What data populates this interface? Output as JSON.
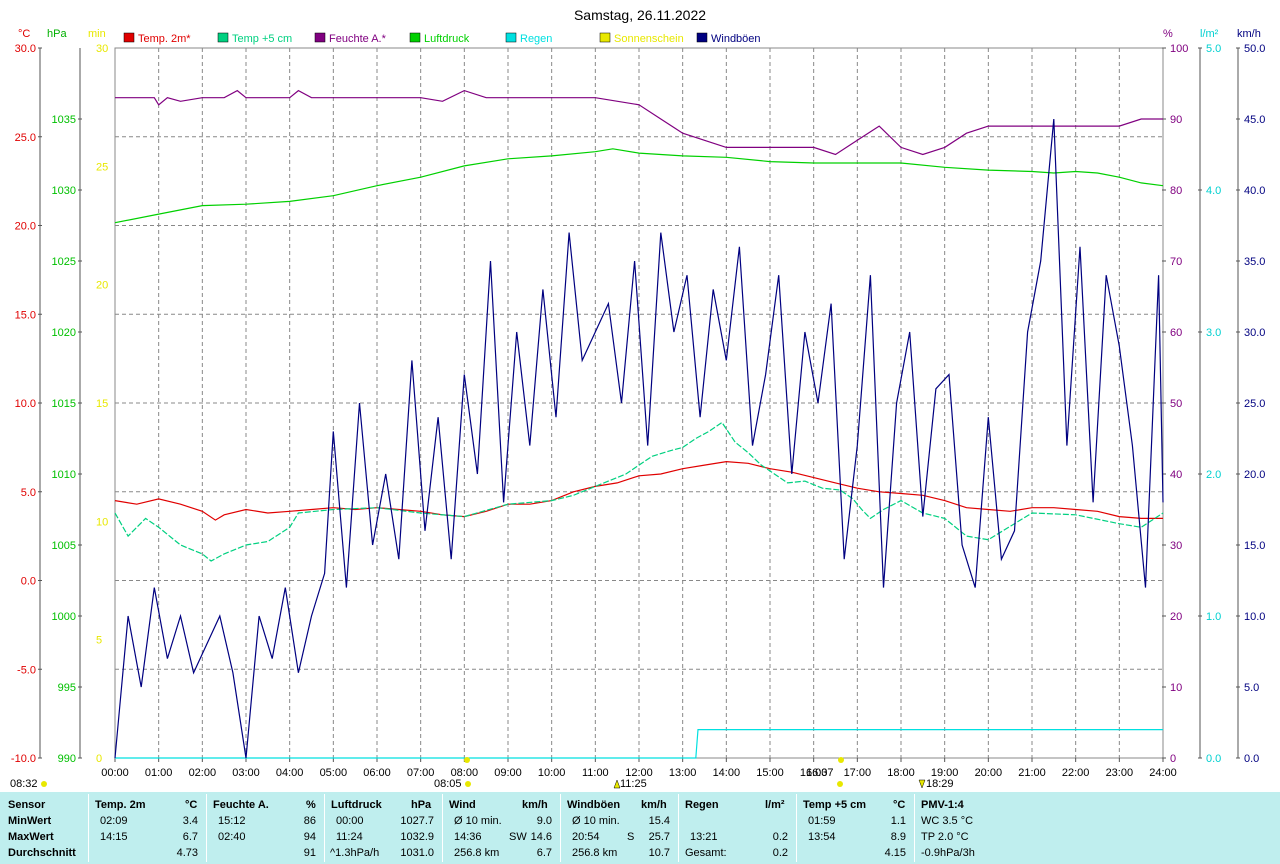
{
  "title": "Samstag, 26.11.2022",
  "axis_units": {
    "temp": "°C",
    "pressure": "hPa",
    "sun": "min",
    "humidity": "%",
    "rain": "l/m²",
    "wind": "km/h"
  },
  "legend": [
    {
      "label": "Temp. 2m*",
      "color": "#e00000"
    },
    {
      "label": "Temp +5 cm",
      "color": "#00d080"
    },
    {
      "label": "Feuchte A.*",
      "color": "#800080"
    },
    {
      "label": "Luftdruck",
      "color": "#00d000"
    },
    {
      "label": "Regen",
      "color": "#00e0e0"
    },
    {
      "label": "Sonnenschein",
      "color": "#e8e800"
    },
    {
      "label": "Windböen",
      "color": "#000080"
    }
  ],
  "sun_events": {
    "sunrise": "08:32",
    "dawn": "08:05",
    "noon": "11:25",
    "dusk": "16:37",
    "sunset": "18:29"
  },
  "chart_data": {
    "type": "line",
    "title": "Samstag, 26.11.2022",
    "x_ticks": [
      "00:00",
      "01:00",
      "02:00",
      "03:00",
      "04:00",
      "05:00",
      "06:00",
      "07:00",
      "08:00",
      "09:00",
      "10:00",
      "11:00",
      "12:00",
      "13:00",
      "14:00",
      "15:00",
      "16:00",
      "17:00",
      "18:00",
      "19:00",
      "20:00",
      "21:00",
      "22:00",
      "23:00",
      "24:00"
    ],
    "xlim": [
      0,
      24
    ],
    "grid": true,
    "axes": {
      "temp": {
        "ticks": [
          "30.0",
          "25.0",
          "20.0",
          "15.0",
          "10.0",
          "5.0",
          "0.0",
          "-5.0",
          "-10.0"
        ],
        "ylim": [
          -10,
          30
        ],
        "color": "#e00000"
      },
      "pressure": {
        "ticks": [
          "1035",
          "1030",
          "1025",
          "1020",
          "1015",
          "1010",
          "1005",
          "1000",
          "995",
          "990"
        ],
        "ylim": [
          990,
          1040
        ],
        "color": "#00c000"
      },
      "sun": {
        "ticks": [
          "30",
          "25",
          "20",
          "15",
          "10",
          "5",
          "0"
        ],
        "ylim": [
          0,
          30
        ],
        "color": "#e8e800"
      },
      "humidity": {
        "ticks": [
          "100",
          "90",
          "80",
          "70",
          "60",
          "50",
          "40",
          "30",
          "20",
          "10",
          "0"
        ],
        "ylim": [
          0,
          100
        ],
        "color": "#800080"
      },
      "rain": {
        "ticks": [
          "5.0",
          "4.0",
          "3.0",
          "2.0",
          "1.0",
          "0.0"
        ],
        "ylim": [
          0,
          5
        ],
        "color": "#00e0e0"
      },
      "wind": {
        "ticks": [
          "50.0",
          "45.0",
          "40.0",
          "35.0",
          "30.0",
          "25.0",
          "20.0",
          "15.0",
          "10.0",
          "5.0",
          "0.0"
        ],
        "ylim": [
          0,
          50
        ],
        "color": "#000080"
      }
    },
    "series": [
      {
        "name": "Temp. 2m*",
        "axis": "temp",
        "color": "#e00000",
        "x": [
          0,
          0.5,
          1,
          1.5,
          2,
          2.3,
          2.5,
          3,
          3.5,
          4,
          4.5,
          5,
          5.5,
          6,
          6.5,
          7,
          7.5,
          8,
          8.5,
          9,
          9.5,
          10,
          10.5,
          11,
          11.5,
          12,
          12.5,
          13,
          13.5,
          14,
          14.5,
          15,
          15.5,
          16,
          16.5,
          17,
          17.5,
          18,
          18.5,
          19,
          19.5,
          20,
          20.5,
          21,
          21.5,
          22,
          22.5,
          23,
          23.5,
          24
        ],
        "y": [
          4.5,
          4.3,
          4.6,
          4.3,
          3.9,
          3.4,
          3.7,
          4.0,
          3.8,
          3.9,
          4.0,
          4.1,
          4.0,
          4.1,
          4.0,
          3.9,
          3.7,
          3.6,
          3.9,
          4.3,
          4.3,
          4.5,
          5.0,
          5.3,
          5.5,
          5.9,
          6.0,
          6.3,
          6.5,
          6.7,
          6.6,
          6.3,
          6.1,
          5.8,
          5.5,
          5.2,
          5.0,
          4.9,
          4.8,
          4.5,
          4.1,
          4.0,
          3.9,
          4.1,
          4.1,
          4.0,
          3.9,
          3.6,
          3.5,
          3.5
        ]
      },
      {
        "name": "Temp +5 cm",
        "axis": "temp",
        "color": "#00d080",
        "x": [
          0,
          0.3,
          0.7,
          1,
          1.5,
          2,
          2.2,
          2.5,
          3,
          3.5,
          4,
          4.2,
          5,
          6,
          7,
          8,
          9,
          10,
          10.5,
          11,
          11.3,
          11.7,
          12,
          12.3,
          12.7,
          13,
          13.3,
          13.6,
          13.9,
          14.2,
          14.5,
          14.8,
          15.1,
          15.4,
          15.8,
          16.2,
          16.6,
          16.9,
          17.1,
          17.3,
          17.6,
          18,
          18.5,
          19,
          19.5,
          20,
          21,
          22,
          23,
          23.5,
          24
        ],
        "y": [
          3.8,
          2.5,
          3.5,
          3.0,
          2.0,
          1.5,
          1.1,
          1.5,
          2.0,
          2.2,
          3.0,
          3.8,
          4.0,
          4.1,
          3.8,
          3.6,
          4.3,
          4.5,
          4.8,
          5.3,
          5.6,
          6.0,
          6.5,
          7.0,
          7.3,
          7.5,
          8.0,
          8.4,
          8.9,
          7.8,
          7.2,
          6.5,
          6.0,
          5.5,
          5.6,
          5.2,
          5.1,
          4.6,
          4.0,
          3.5,
          4.0,
          4.5,
          3.8,
          3.5,
          2.5,
          2.3,
          3.8,
          3.7,
          3.2,
          3.0,
          3.8
        ]
      },
      {
        "name": "Feuchte A.*",
        "axis": "humidity",
        "color": "#800080",
        "x": [
          0,
          0.9,
          1,
          1.2,
          1.5,
          2,
          2.5,
          2.8,
          3,
          3.5,
          4,
          4.2,
          4.5,
          5,
          5.5,
          6,
          6.5,
          7,
          7.5,
          8,
          8.5,
          9,
          10,
          11,
          12,
          12.5,
          13,
          13.5,
          14,
          14.5,
          15,
          16,
          16.5,
          17,
          17.5,
          18,
          18.5,
          19,
          19.5,
          20,
          21,
          22,
          23,
          23.5,
          24
        ],
        "y": [
          93,
          93,
          92,
          93,
          92.5,
          93,
          93,
          94,
          93,
          93,
          93,
          94,
          93,
          93,
          93,
          93,
          93,
          93,
          92.5,
          94,
          93,
          93,
          93,
          93,
          92,
          90,
          88,
          87,
          86,
          86,
          86,
          86,
          85,
          87,
          89,
          86,
          85,
          86,
          88,
          89,
          89,
          89,
          89,
          90,
          90
        ]
      },
      {
        "name": "Luftdruck",
        "axis": "pressure",
        "color": "#00d000",
        "x": [
          0,
          1,
          2,
          3,
          4,
          5,
          6,
          7,
          8,
          9,
          10,
          11,
          11.4,
          12,
          13,
          14,
          15,
          16,
          17,
          18,
          19,
          20,
          21,
          21.5,
          22,
          22.5,
          23,
          23.5,
          24
        ],
        "y": [
          1027.7,
          1028.3,
          1028.9,
          1029.0,
          1029.2,
          1029.6,
          1030.3,
          1030.9,
          1031.7,
          1032.2,
          1032.4,
          1032.7,
          1032.9,
          1032.6,
          1032.4,
          1032.3,
          1032.0,
          1031.9,
          1031.9,
          1031.9,
          1031.6,
          1031.4,
          1031.3,
          1031.2,
          1031.3,
          1031.2,
          1030.9,
          1030.5,
          1030.3
        ]
      },
      {
        "name": "Regen",
        "axis": "rain",
        "color": "#00e0e0",
        "x": [
          0,
          13.3,
          13.35,
          24
        ],
        "y": [
          0,
          0,
          0.2,
          0.2
        ]
      },
      {
        "name": "Windböen",
        "axis": "wind",
        "color": "#000080",
        "x": [
          0,
          0.3,
          0.6,
          0.9,
          1.2,
          1.5,
          1.8,
          2.1,
          2.4,
          2.7,
          3.0,
          3.3,
          3.6,
          3.9,
          4.2,
          4.5,
          4.8,
          5.0,
          5.3,
          5.6,
          5.9,
          6.2,
          6.5,
          6.8,
          7.1,
          7.4,
          7.7,
          8.0,
          8.3,
          8.6,
          8.9,
          9.2,
          9.5,
          9.8,
          10.1,
          10.4,
          10.7,
          11.0,
          11.3,
          11.6,
          11.9,
          12.2,
          12.5,
          12.8,
          13.1,
          13.4,
          13.7,
          14.0,
          14.3,
          14.6,
          14.9,
          15.2,
          15.5,
          15.8,
          16.1,
          16.4,
          16.7,
          17.0,
          17.3,
          17.6,
          17.9,
          18.2,
          18.5,
          18.8,
          19.1,
          19.4,
          19.7,
          20.0,
          20.3,
          20.6,
          20.9,
          21.2,
          21.5,
          21.8,
          22.1,
          22.4,
          22.7,
          23.0,
          23.3,
          23.6,
          23.9,
          24
        ],
        "y": [
          0,
          10,
          5,
          12,
          7,
          10,
          6,
          8,
          10,
          6,
          0,
          10,
          7,
          12,
          6,
          10,
          13,
          23,
          12,
          25,
          15,
          20,
          14,
          28,
          16,
          24,
          14,
          27,
          20,
          35,
          18,
          30,
          22,
          33,
          24,
          37,
          28,
          30,
          32,
          25,
          35,
          22,
          37,
          30,
          34,
          24,
          33,
          28,
          36,
          22,
          27,
          34,
          20,
          30,
          25,
          32,
          14,
          22,
          34,
          12,
          25,
          30,
          17,
          26,
          27,
          15,
          12,
          24,
          14,
          16,
          30,
          35,
          45,
          22,
          36,
          18,
          34,
          29,
          22,
          12,
          34,
          18
        ]
      }
    ]
  },
  "stats": {
    "headers": [
      {
        "name": "Sensor",
        "unit": ""
      },
      {
        "name": "Temp. 2m",
        "unit": "°C"
      },
      {
        "name": "Feuchte A.",
        "unit": "%"
      },
      {
        "name": "Luftdruck",
        "unit": "hPa"
      },
      {
        "name": "Wind",
        "unit": "km/h"
      },
      {
        "name": "Windböen",
        "unit": "km/h"
      },
      {
        "name": "Regen",
        "unit": "l/m²"
      },
      {
        "name": "Temp +5 cm",
        "unit": "°C"
      },
      {
        "name": "PMV-1:4",
        "unit": ""
      }
    ],
    "rows": [
      {
        "label": "MinWert",
        "temp_time": "02:09",
        "temp_val": "3.4",
        "hum_time": "15:12",
        "hum_val": "86",
        "press_time": "00:00",
        "press_val": "1027.7",
        "wind_label": "Ø 10 min.",
        "wind_dir": "",
        "wind_val": "9.0",
        "gust_label": "Ø 10 min.",
        "gust_dir": "",
        "gust_val": "15.4",
        "rain_time": "",
        "rain_val": "",
        "t5_time": "01:59",
        "t5_val": "1.1",
        "pmv": "WC 3.5 °C"
      },
      {
        "label": "MaxWert",
        "temp_time": "14:15",
        "temp_val": "6.7",
        "hum_time": "02:40",
        "hum_val": "94",
        "press_time": "11:24",
        "press_val": "1032.9",
        "wind_label": "14:36",
        "wind_dir": "SW",
        "wind_val": "14.6",
        "gust_label": "20:54",
        "gust_dir": "S",
        "gust_val": "25.7",
        "rain_time": "13:21",
        "rain_val": "0.2",
        "t5_time": "13:54",
        "t5_val": "8.9",
        "pmv": "TP 2.0 °C"
      },
      {
        "label": "Durchschnitt",
        "temp_time": "",
        "temp_val": "4.73",
        "hum_time": "",
        "hum_val": "91",
        "press_time": "^1.3hPa/h",
        "press_val": "1031.0",
        "wind_label": "256.8 km",
        "wind_dir": "",
        "wind_val": "6.7",
        "gust_label": "256.8 km",
        "gust_dir": "",
        "gust_val": "10.7",
        "rain_time": "Gesamt:",
        "rain_val": "0.2",
        "t5_time": "",
        "t5_val": "4.15",
        "pmv": "-0.9hPa/3h"
      }
    ]
  }
}
